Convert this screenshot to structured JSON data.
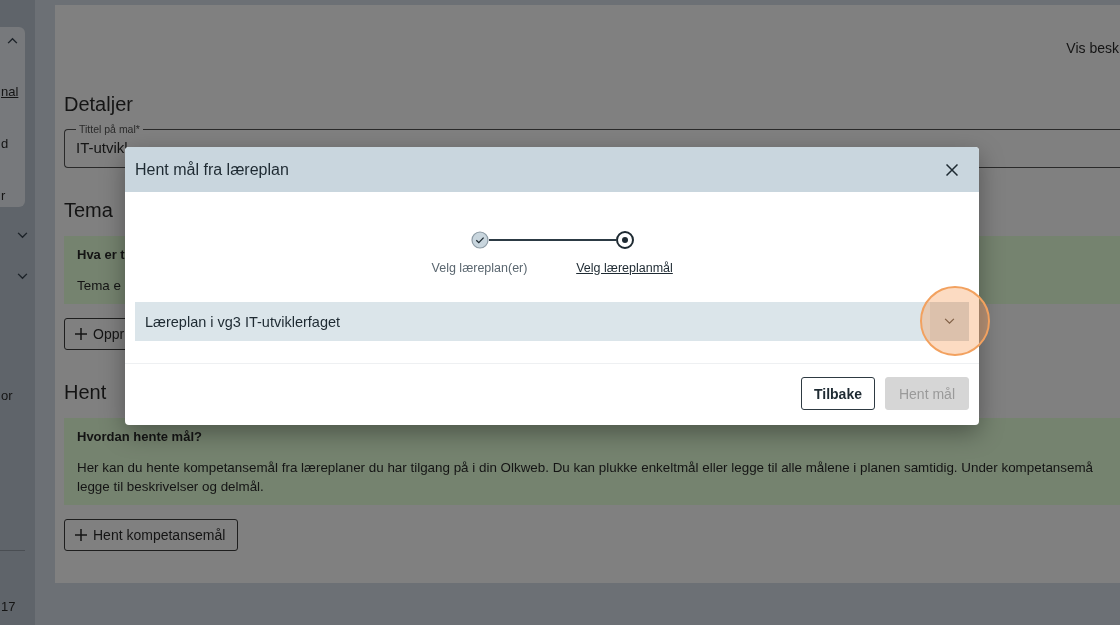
{
  "sidebar": {
    "group": {
      "expanded": true,
      "items": [
        {
          "label": "nal",
          "link": true
        },
        {
          "label": "d",
          "link": false
        },
        {
          "label": "r",
          "link": false
        }
      ]
    },
    "more_groups": [
      {
        "expanded": false
      },
      {
        "expanded": false
      }
    ],
    "item": "or",
    "footer": "17"
  },
  "page": {
    "top_link": "Vis besk",
    "sections": [
      {
        "kind": "field",
        "heading": "Detaljer",
        "field": {
          "label": "Tittel på mal*",
          "value": "IT-utvikl"
        }
      },
      {
        "kind": "info",
        "heading": "Tema",
        "info": {
          "title": "Hva er t",
          "lines": [
            "Tema e"
          ]
        },
        "button": "Oppr"
      },
      {
        "kind": "info",
        "heading": "Hent",
        "info": {
          "title": "Hvordan hente mål?",
          "lines": [
            "Her kan du hente kompetansemål fra læreplaner du har tilgang på i din Olkweb. Du kan plukke enkeltmål eller legge til alle målene i planen samtidig. Under kompetansemå",
            "legge til beskrivelser og delmål."
          ]
        },
        "button": "Hent kompetansemål"
      }
    ]
  },
  "dialog": {
    "title": "Hent mål fra læreplan",
    "steps": [
      {
        "label": "Velg læreplan(er)",
        "completed": true,
        "selected": false
      },
      {
        "label": "Velg læreplanmål",
        "completed": false,
        "selected": true
      }
    ],
    "accordion": {
      "title": "Læreplan i vg3 IT-utviklerfaget",
      "expanded": false,
      "highlighted": true
    },
    "buttons": [
      {
        "label": "Tilbake",
        "disabled": false
      },
      {
        "label": "Hent mål",
        "disabled": true
      }
    ]
  }
}
